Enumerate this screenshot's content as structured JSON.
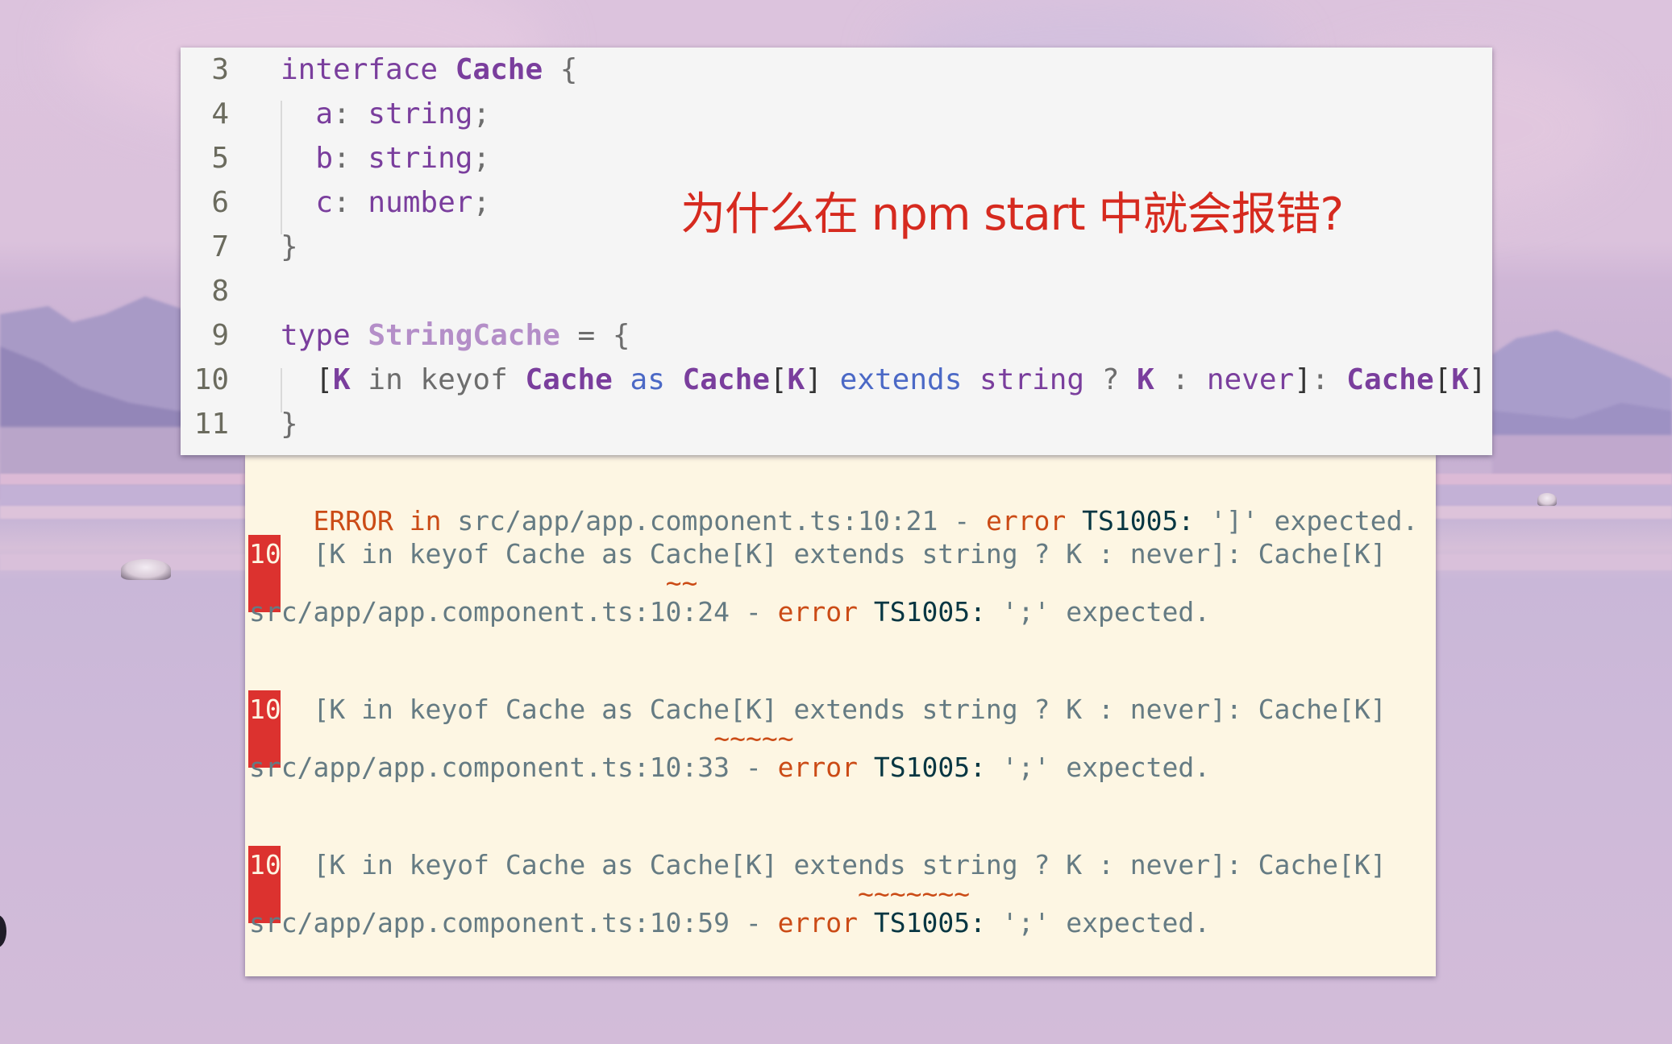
{
  "editor": {
    "lines": [
      {
        "num": "3",
        "tokens": [
          {
            "t": "interface ",
            "c": "kw"
          },
          {
            "t": "Cache",
            "c": "ty"
          },
          {
            "t": " {",
            "c": "punc"
          }
        ]
      },
      {
        "num": "4",
        "tokens": [
          {
            "t": "  a",
            "c": "prop"
          },
          {
            "t": ": ",
            "c": "punc"
          },
          {
            "t": "string",
            "c": "kw"
          },
          {
            "t": ";",
            "c": "punc"
          }
        ]
      },
      {
        "num": "5",
        "tokens": [
          {
            "t": "  b",
            "c": "prop"
          },
          {
            "t": ": ",
            "c": "punc"
          },
          {
            "t": "string",
            "c": "kw"
          },
          {
            "t": ";",
            "c": "punc"
          }
        ]
      },
      {
        "num": "6",
        "tokens": [
          {
            "t": "  c",
            "c": "prop"
          },
          {
            "t": ": ",
            "c": "punc"
          },
          {
            "t": "number",
            "c": "kw"
          },
          {
            "t": ";",
            "c": "punc"
          }
        ]
      },
      {
        "num": "7",
        "tokens": [
          {
            "t": "}",
            "c": "punc"
          }
        ]
      },
      {
        "num": "8",
        "tokens": []
      },
      {
        "num": "9",
        "tokens": [
          {
            "t": "type ",
            "c": "kw"
          },
          {
            "t": "StringCache",
            "c": "tyl"
          },
          {
            "t": " = {",
            "c": "punc"
          }
        ]
      },
      {
        "num": "10",
        "tokens": [
          {
            "t": "  [",
            "c": "brk"
          },
          {
            "t": "K",
            "c": "ty"
          },
          {
            "t": " in keyof ",
            "c": "plain"
          },
          {
            "t": "Cache",
            "c": "ty"
          },
          {
            "t": " as ",
            "c": "blue"
          },
          {
            "t": "Cache",
            "c": "ty"
          },
          {
            "t": "[",
            "c": "brk"
          },
          {
            "t": "K",
            "c": "ty"
          },
          {
            "t": "] ",
            "c": "brk"
          },
          {
            "t": "extends ",
            "c": "blue"
          },
          {
            "t": "string",
            "c": "kw"
          },
          {
            "t": " ? ",
            "c": "punc"
          },
          {
            "t": "K",
            "c": "ty"
          },
          {
            "t": " : ",
            "c": "punc"
          },
          {
            "t": "never",
            "c": "kw"
          },
          {
            "t": "]",
            "c": "brk"
          },
          {
            "t": ": ",
            "c": "punc"
          },
          {
            "t": "Cache",
            "c": "ty"
          },
          {
            "t": "[",
            "c": "brk"
          },
          {
            "t": "K",
            "c": "ty"
          },
          {
            "t": "]",
            "c": "brk"
          }
        ]
      },
      {
        "num": "11",
        "tokens": [
          {
            "t": "}",
            "c": "punc"
          }
        ]
      }
    ]
  },
  "annotation": {
    "question": "为什么在 npm start 中就会报错?",
    "color": "#d62a1f"
  },
  "terminal": {
    "header": {
      "error_word": "ERROR",
      "in_word": " in ",
      "file": "src/app/app.component.ts:10:21",
      "dash": " - ",
      "error_label": "error",
      "code": " TS1005:",
      "message": " ']' expected."
    },
    "blocks": [
      {
        "line_no": "10",
        "source": "  [K in keyof Cache as Cache[K] extends string ? K : never]: Cache[K]",
        "squiggle": "~~",
        "squiggle_col": 24,
        "file": "src/app/app.component.ts:10:24",
        "dash": " - ",
        "error_label": "error",
        "code": " TS1005:",
        "message": " ';' expected."
      },
      {
        "line_no": "10",
        "source": "  [K in keyof Cache as Cache[K] extends string ? K : never]: Cache[K]",
        "squiggle": "~~~~~",
        "squiggle_col": 27,
        "file": "src/app/app.component.ts:10:33",
        "dash": " - ",
        "error_label": "error",
        "code": " TS1005:",
        "message": " ';' expected."
      },
      {
        "line_no": "10",
        "source": "  [K in keyof Cache as Cache[K] extends string ? K : never]: Cache[K]",
        "squiggle": "~~~~~~~",
        "squiggle_col": 36,
        "file": "src/app/app.component.ts:10:59",
        "dash": " - ",
        "error_label": "error",
        "code": " TS1005:",
        "message": " ';' expected."
      }
    ],
    "colors": {
      "background": "#fdf6e3",
      "error": "#cb4b16",
      "gutter": "#dc322f",
      "text": "#657b83",
      "code": "#073642"
    }
  }
}
